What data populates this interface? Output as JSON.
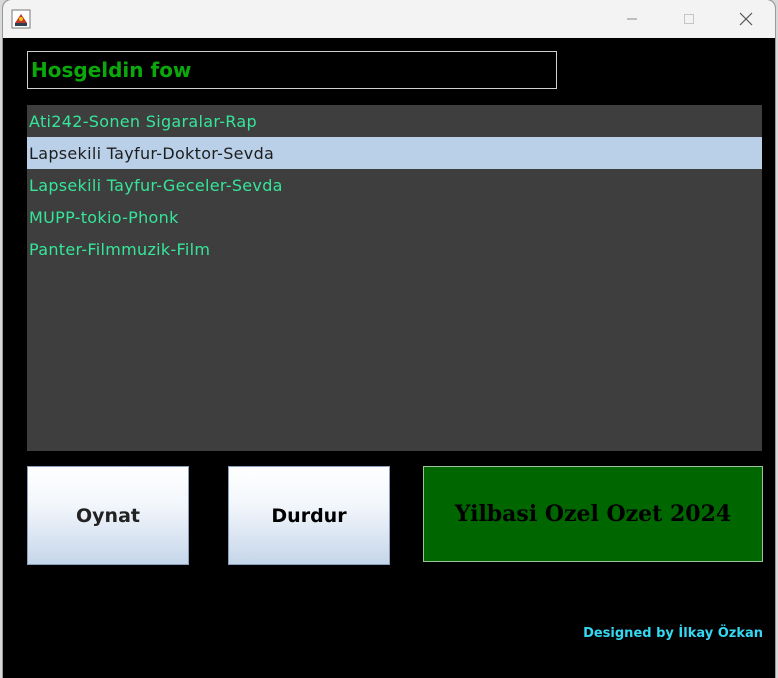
{
  "window": {
    "controls": {
      "minimize": "minimize-icon",
      "maximize": "maximize-icon",
      "close": "close-icon"
    },
    "app_icon": "java-app-icon"
  },
  "welcome": {
    "text": "Hosgeldin fow"
  },
  "songs": [
    {
      "label": "Ati242-Sonen Sigaralar-Rap",
      "selected": false
    },
    {
      "label": "Lapsekili Tayfur-Doktor-Sevda",
      "selected": true
    },
    {
      "label": "Lapsekili Tayfur-Geceler-Sevda",
      "selected": false
    },
    {
      "label": "MUPP-tokio-Phonk",
      "selected": false
    },
    {
      "label": "Panter-Filmmuzik-Film",
      "selected": false
    }
  ],
  "buttons": {
    "play": "Oynat",
    "stop": "Durdur",
    "promo": "Yilbasi Ozel Ozet 2024"
  },
  "footer": {
    "credit": "Designed by İlkay Özkan"
  },
  "colors": {
    "background": "#000000",
    "list_bg": "#3e3e3e",
    "list_text": "#35e69a",
    "selection_bg": "#b9d0e8",
    "welcome_text": "#0aa80a",
    "promo_bg": "#006600",
    "credit_text": "#35d8f2"
  }
}
